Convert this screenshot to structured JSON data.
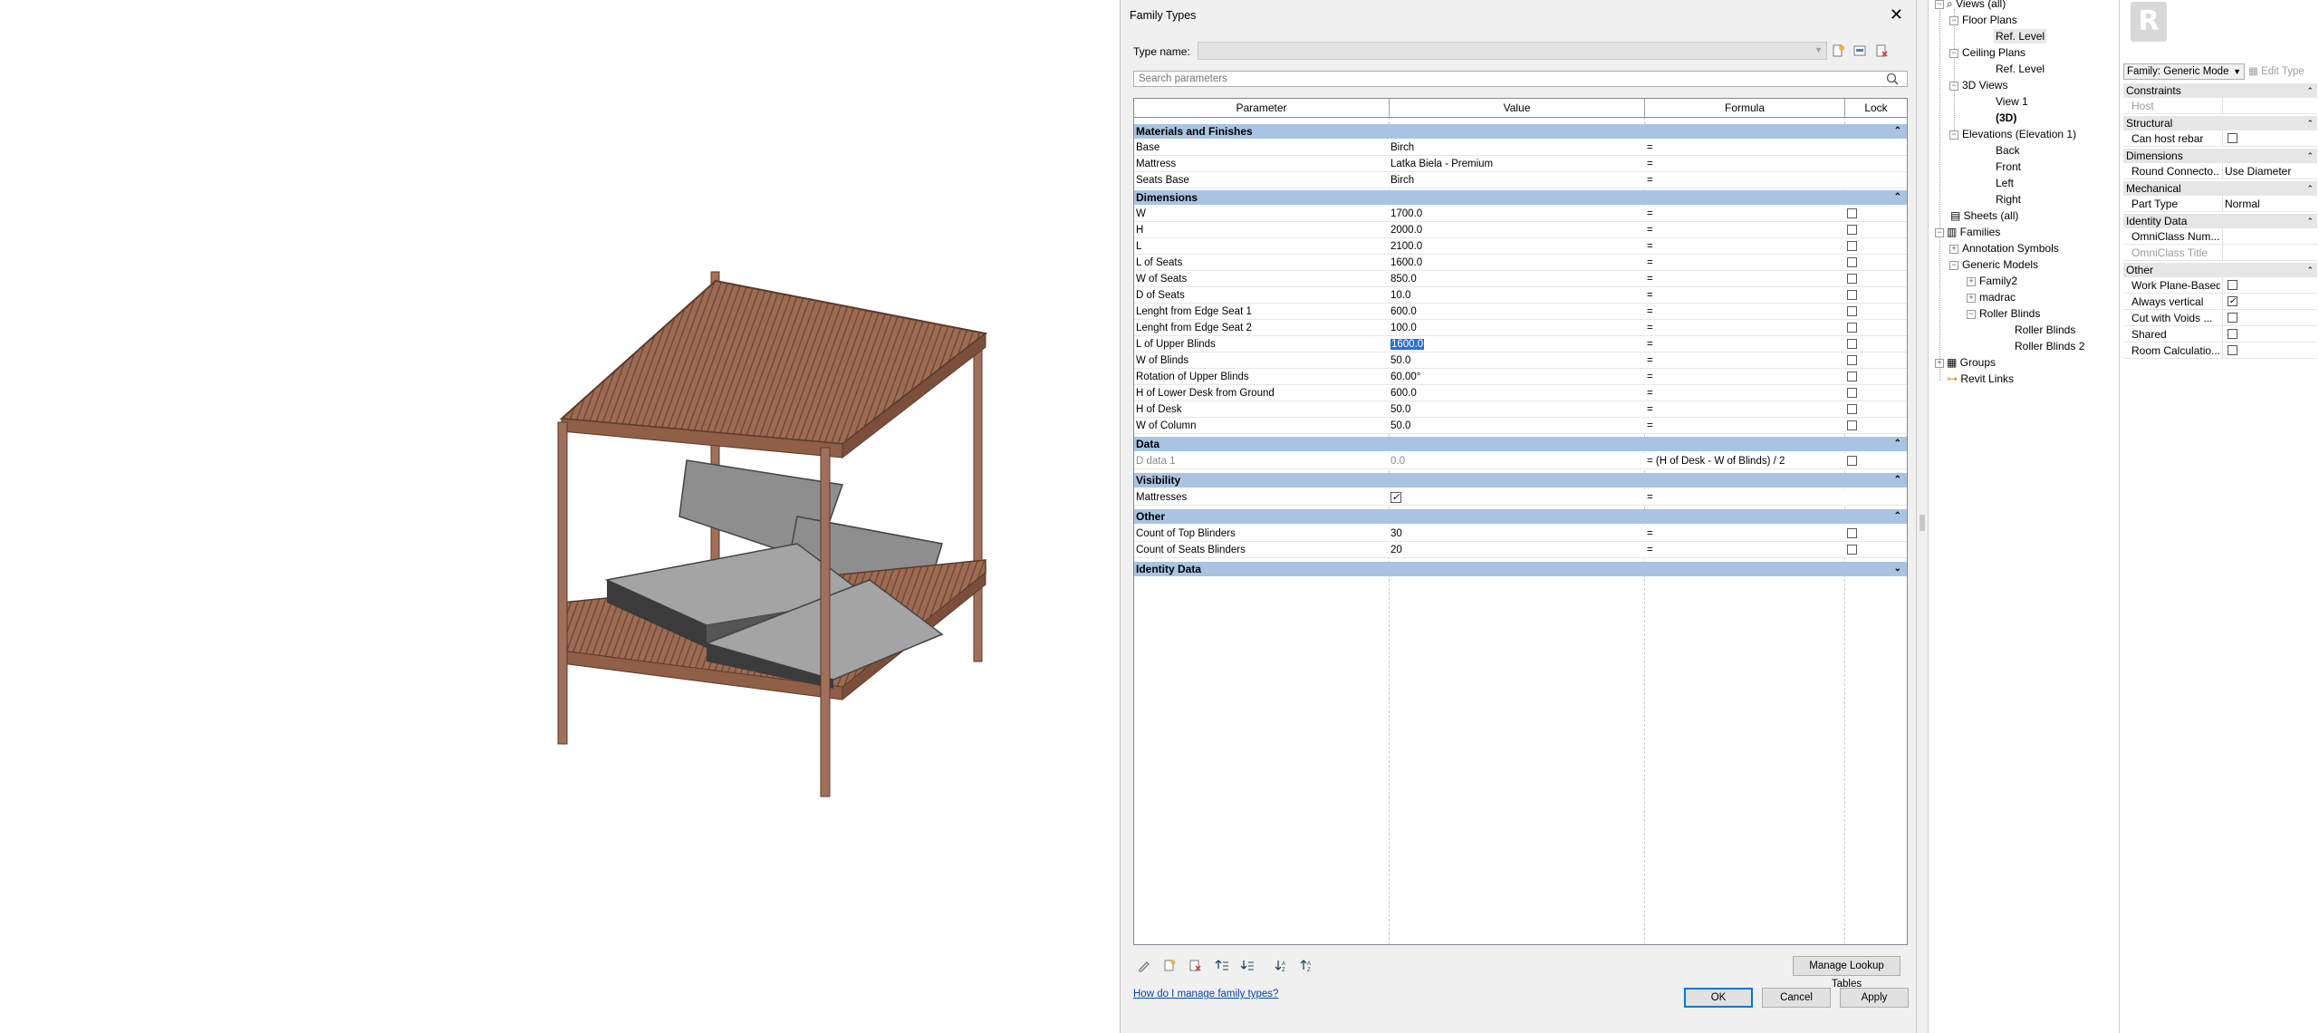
{
  "dialog": {
    "title": "Family Types",
    "type_name_label": "Type name:",
    "type_name_value": "",
    "search_placeholder": "Search parameters",
    "columns": {
      "parameter": "Parameter",
      "value": "Value",
      "formula": "Formula",
      "lock": "Lock"
    },
    "groups": [
      {
        "label": "Materials and Finishes",
        "rows": [
          {
            "param": "Base",
            "value": "Birch",
            "formula": "="
          },
          {
            "param": "Mattress",
            "value": "Latka Biela - Premium",
            "formula": "="
          },
          {
            "param": "Seats Base",
            "value": "Birch",
            "formula": "="
          }
        ]
      },
      {
        "label": "Dimensions",
        "rows": [
          {
            "param": "W",
            "value": "1700.0",
            "formula": "="
          },
          {
            "param": "H",
            "value": "2000.0",
            "formula": "="
          },
          {
            "param": "L",
            "value": "2100.0",
            "formula": "="
          },
          {
            "param": "L of Seats",
            "value": "1600.0",
            "formula": "="
          },
          {
            "param": "W of Seats",
            "value": "850.0",
            "formula": "="
          },
          {
            "param": "D of Seats",
            "value": "10.0",
            "formula": "="
          },
          {
            "param": "Lenght from Edge Seat 1",
            "value": "600.0",
            "formula": "="
          },
          {
            "param": "Lenght from Edge Seat 2",
            "value": "100.0",
            "formula": "="
          },
          {
            "param": "L of Upper Blinds",
            "value": "1600.0",
            "formula": "="
          },
          {
            "param": "W of Blinds",
            "value": "50.0",
            "formula": "="
          },
          {
            "param": "Rotation of Upper Blinds",
            "value": "60.00°",
            "formula": "="
          },
          {
            "param": "H of Lower Desk from Ground",
            "value": "600.0",
            "formula": "="
          },
          {
            "param": "H of Desk",
            "value": "50.0",
            "formula": "="
          },
          {
            "param": "W of Column",
            "value": "50.0",
            "formula": "="
          }
        ]
      },
      {
        "label": "Data",
        "rows": [
          {
            "param": "D data 1",
            "value": "0.0",
            "formula": "= (H of Desk - W of Blinds) / 2"
          }
        ]
      },
      {
        "label": "Visibility",
        "rows": [
          {
            "param": "Mattresses",
            "value": "",
            "formula": "="
          }
        ]
      },
      {
        "label": "Other",
        "rows": [
          {
            "param": "Count of Top Blinders",
            "value": "30",
            "formula": "="
          },
          {
            "param": "Count of Seats Blinders",
            "value": "20",
            "formula": "="
          }
        ]
      },
      {
        "label": "Identity Data",
        "rows": []
      }
    ],
    "manage_lookup_tables": "Manage Lookup Tables",
    "help_link": "How do I manage family types?",
    "ok": "OK",
    "cancel": "Cancel",
    "apply": "Apply"
  },
  "browser": {
    "items": [
      "Views (all)",
      "Floor Plans",
      "Ref. Level",
      "Ceiling Plans",
      "Ref. Level",
      "3D Views",
      "View 1",
      "(3D)",
      "Elevations (Elevation 1)",
      "Back",
      "Front",
      "Left",
      "Right",
      "Sheets (all)",
      "Families",
      "Annotation Symbols",
      "Generic Models",
      "Family2",
      "madrac",
      "Roller Blinds",
      "Roller Blinds",
      "Roller Blinds 2",
      "Groups",
      "Revit Links"
    ]
  },
  "properties": {
    "app_logo": "R",
    "family_selector": "Family: Generic Mode",
    "edit_type": "Edit Type",
    "sections": [
      {
        "label": "Constraints"
      },
      {
        "label": "Structural"
      },
      {
        "label": "Dimensions"
      },
      {
        "label": "Mechanical"
      },
      {
        "label": "Identity Data"
      },
      {
        "label": "Other"
      }
    ],
    "rows": {
      "host": "Host",
      "can_host_rebar": "Can host rebar",
      "round_connector": "Round Connecto...",
      "round_connector_value": "Use Diameter",
      "part_type": "Part Type",
      "part_type_value": "Normal",
      "omniclass_num": "OmniClass Num...",
      "omniclass_title": "OmniClass Title",
      "work_plane_based": "Work Plane-Based",
      "always_vertical": "Always vertical",
      "cut_with_voids": "Cut with Voids ...",
      "shared": "Shared",
      "room_calc": "Room Calculatio..."
    }
  },
  "colors": {
    "group_header": "#a9c4e2",
    "wood": "#a0705a",
    "mattress": "#9a9a9a",
    "selection": "#2a6fd6"
  }
}
